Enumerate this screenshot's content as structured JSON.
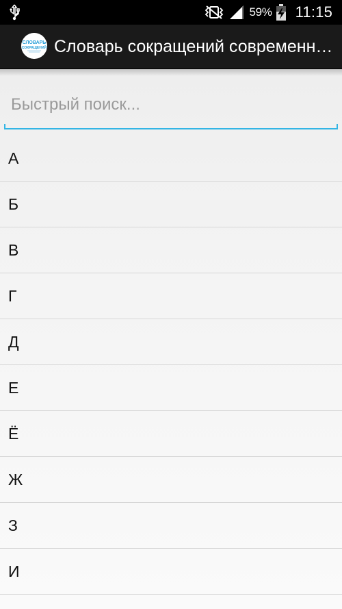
{
  "status_bar": {
    "battery_percent": "59%",
    "time": "11:15",
    "icons": [
      "usb-icon",
      "vibrate-icon",
      "signal-icon",
      "battery-charging-icon"
    ]
  },
  "action_bar": {
    "title": "Словарь сокращений современн…",
    "logo": {
      "line1": "СЛОВАРЬ",
      "line2": "СОКРАЩЕНИЙ",
      "accent_color": "#2a9fd8"
    }
  },
  "search": {
    "placeholder": "Быстрый поиск...",
    "value": "",
    "accent_color": "#33b5e5"
  },
  "letters": [
    "А",
    "Б",
    "В",
    "Г",
    "Д",
    "Е",
    "Ё",
    "Ж",
    "З",
    "И"
  ]
}
